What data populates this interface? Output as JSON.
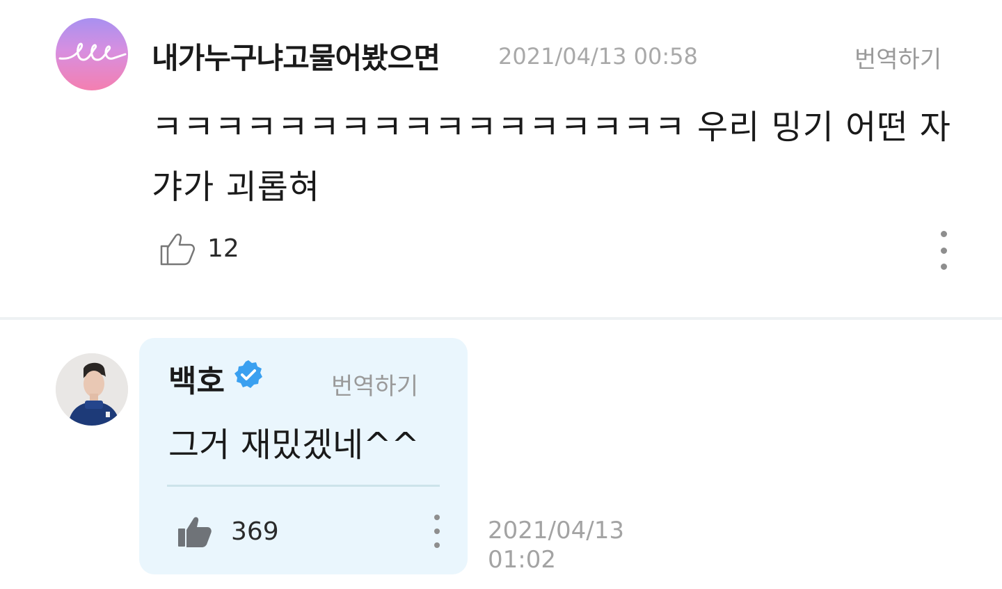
{
  "comment": {
    "username": "내가누구냐고물어봤으면",
    "timestamp": "2021/04/13 00:58",
    "translate_label": "번역하기",
    "text": "ㅋㅋㅋㅋㅋㅋㅋㅋㅋㅋㅋㅋㅋㅋㅋㅋㅋ 우리 밍기 어떤 자갸가 괴롭혀",
    "likes": "12",
    "avatar_icon": "pink-gradient-signature-avatar",
    "like_icon": "thumbs-up-outline-icon",
    "more_icon": "more-vertical-icon"
  },
  "reply": {
    "username": "백호",
    "verified_icon": "verified-badge-icon",
    "translate_label": "번역하기",
    "text": "그거 재밌겠네^^",
    "likes": "369",
    "date_line1": "2021/04/13",
    "date_line2": "01:02",
    "avatar_icon": "artist-profile-photo",
    "like_icon": "thumbs-up-filled-icon",
    "more_icon": "more-vertical-icon",
    "bubble_color": "#eaf6fd",
    "verified_color": "#3aa0f0"
  }
}
